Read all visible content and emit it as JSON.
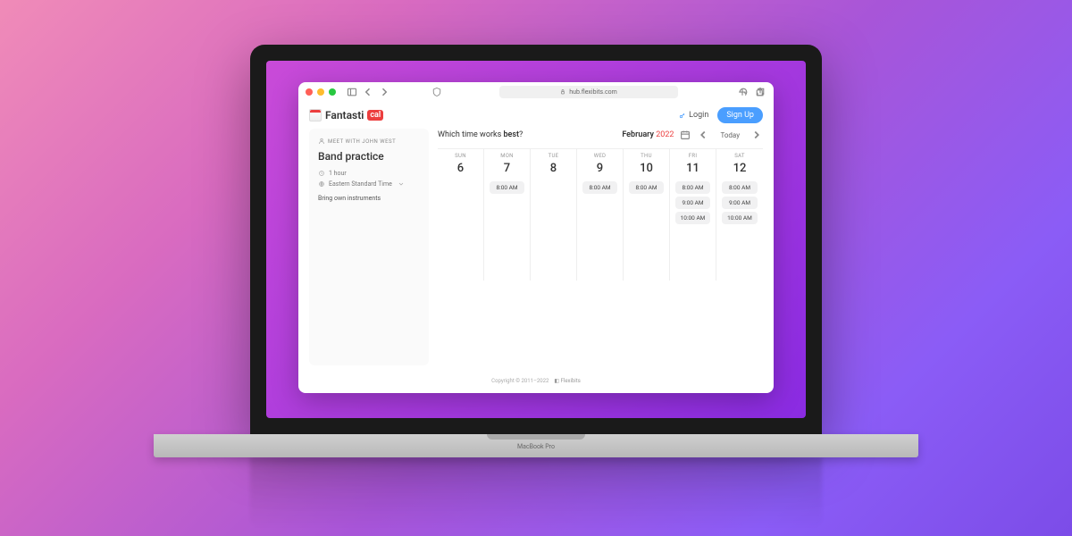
{
  "browser": {
    "url": "hub.flexibits.com"
  },
  "brand": {
    "name": "Fantasti",
    "suffix": "cal"
  },
  "auth": {
    "login": "Login",
    "signup": "Sign Up"
  },
  "event": {
    "meet_with_label": "MEET WITH JOHN WEST",
    "title": "Band practice",
    "duration": "1 hour",
    "timezone": "Eastern Standard Time",
    "note": "Bring own instruments"
  },
  "scheduler": {
    "prompt_prefix": "Which time works ",
    "prompt_bold": "best",
    "prompt_suffix": "?",
    "month": "February",
    "year": "2022",
    "today_label": "Today",
    "days": [
      {
        "dow": "SUN",
        "num": "6",
        "slots": []
      },
      {
        "dow": "MON",
        "num": "7",
        "slots": [
          "8:00 AM"
        ]
      },
      {
        "dow": "TUE",
        "num": "8",
        "slots": []
      },
      {
        "dow": "WED",
        "num": "9",
        "slots": [
          "8:00 AM"
        ]
      },
      {
        "dow": "THU",
        "num": "10",
        "slots": [
          "8:00 AM"
        ]
      },
      {
        "dow": "FRI",
        "num": "11",
        "slots": [
          "8:00 AM",
          "9:00 AM",
          "10:00 AM"
        ]
      },
      {
        "dow": "SAT",
        "num": "12",
        "slots": [
          "8:00 AM",
          "9:00 AM",
          "10:00 AM"
        ]
      }
    ]
  },
  "footer": {
    "copyright": "Copyright © 2011–2022",
    "brand": "Flexibits"
  },
  "laptop": {
    "model": "MacBook Pro"
  }
}
